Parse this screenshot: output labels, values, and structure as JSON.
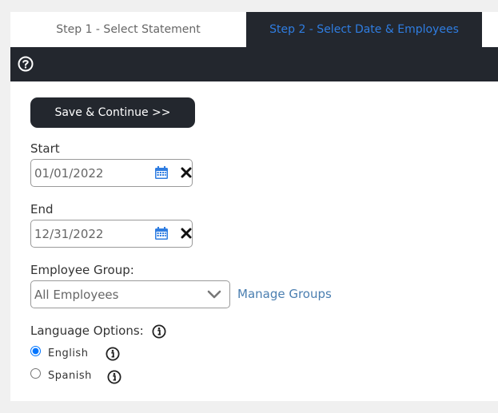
{
  "tabs": [
    {
      "label": "Step 1 - Select Statement"
    },
    {
      "label": "Step 2 - Select Date & Employees"
    }
  ],
  "toolbar": {
    "help_icon": "question-circle-icon"
  },
  "form": {
    "save_label": "Save & Continue >>",
    "start": {
      "label": "Start",
      "value": "01/01/2022"
    },
    "end": {
      "label": "End",
      "value": "12/31/2022"
    },
    "employee_group": {
      "label": "Employee Group:",
      "selected": "All Employees",
      "manage_link": "Manage Groups"
    },
    "language": {
      "label": "Language Options:",
      "options": [
        {
          "label": "English",
          "checked": true
        },
        {
          "label": "Spanish",
          "checked": false
        }
      ]
    }
  },
  "colors": {
    "dark": "#23272e",
    "active_tab_text": "#2f7de1",
    "link": "#4a7eb0",
    "calendar_icon": "#2f7de1"
  }
}
